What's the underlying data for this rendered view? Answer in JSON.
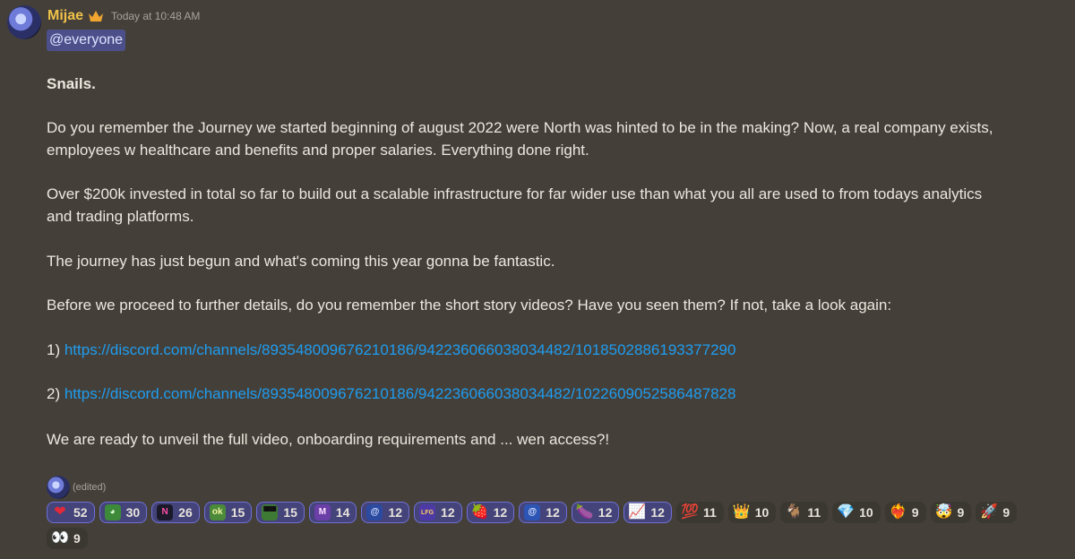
{
  "message": {
    "username": "Mijae",
    "timestamp": "Today at 10:48 AM",
    "mention": "@everyone",
    "heading": "Snails.",
    "lines": [
      "Do you remember the Journey we started beginning of august 2022 were North was hinted to be in the making? Now, a real company exists,",
      "employees w healthcare and benefits and proper salaries. Everything done right.",
      "Over $200k invested in total so far to build out a scalable infrastructure for far wider use than what you all are used to from todays analytics",
      "and trading platforms.",
      "The journey has just begun and what's coming this year gonna be fantastic.",
      "Before we proceed to further details, do you remember the short story videos? Have you seen them? If not, take a look again:",
      "We are ready to unveil the full video, onboarding requirements and ... wen access?!"
    ],
    "link1_prefix": "1) ",
    "link1": "https://discord.com/channels/893548009676210186/942236066038034482/1018502886193377290",
    "link2_prefix": "2) ",
    "link2": "https://discord.com/channels/893548009676210186/942236066038034482/1022609052586487828",
    "edited": "(edited)"
  },
  "colors": {
    "background": "#444039",
    "username": "#f0c24a",
    "link": "#1f9cf0",
    "mention_bg": "#4c4f8a",
    "reaction_active_border": "#6f6fd6"
  },
  "reactions": [
    {
      "icon": "red-heart-icon",
      "glyph": "❤",
      "count": "52",
      "active": true
    },
    {
      "icon": "pepe-frog-icon",
      "glyph": "",
      "count": "30",
      "active": true
    },
    {
      "icon": "server-logo-icon",
      "glyph": "",
      "count": "26",
      "active": true
    },
    {
      "icon": "pepe-ok-icon",
      "glyph": "",
      "count": "15",
      "active": true
    },
    {
      "icon": "pepe-sunglasses-icon",
      "glyph": "",
      "count": "15",
      "active": true
    },
    {
      "icon": "moon-emote-icon",
      "glyph": "",
      "count": "14",
      "active": true
    },
    {
      "icon": "snail-nice-emote-icon",
      "glyph": "",
      "count": "12",
      "active": true
    },
    {
      "icon": "lfg-emote-icon",
      "glyph": "",
      "count": "12",
      "active": true
    },
    {
      "icon": "strawberry-icon",
      "glyph": "🍓",
      "count": "12",
      "active": true
    },
    {
      "icon": "snail-gm-emote-icon",
      "glyph": "",
      "count": "12",
      "active": true
    },
    {
      "icon": "eggplant-icon",
      "glyph": "🍆",
      "count": "12",
      "active": true
    },
    {
      "icon": "chart-increasing-icon",
      "glyph": "📈",
      "count": "12",
      "active": true
    },
    {
      "icon": "hundred-points-icon",
      "glyph": "💯",
      "count": "11",
      "active": false
    },
    {
      "icon": "crown-icon",
      "glyph": "👑",
      "count": "10",
      "active": false
    },
    {
      "icon": "goat-icon",
      "glyph": "🐐",
      "count": "11",
      "active": false
    },
    {
      "icon": "gem-stone-icon",
      "glyph": "💎",
      "count": "10",
      "active": false
    },
    {
      "icon": "heart-on-fire-icon",
      "glyph": "❤‍🔥",
      "count": "9",
      "active": false
    },
    {
      "icon": "exploding-head-icon",
      "glyph": "🤯",
      "count": "9",
      "active": false
    },
    {
      "icon": "rocket-icon",
      "glyph": "🚀",
      "count": "9",
      "active": false
    },
    {
      "icon": "eyes-icon",
      "glyph": "👀",
      "count": "9",
      "active": false
    }
  ]
}
